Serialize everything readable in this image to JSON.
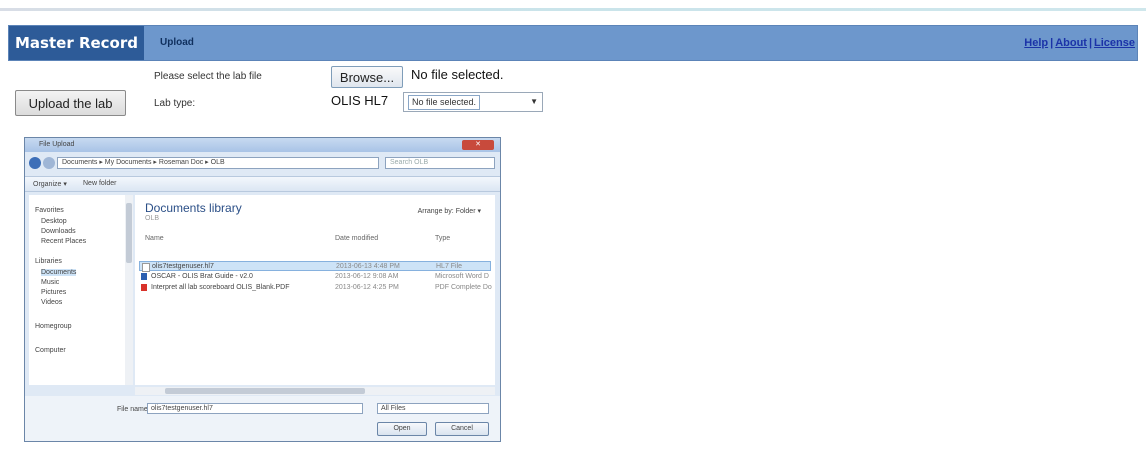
{
  "header": {
    "brand": "Master Record",
    "section": "Upload",
    "links": [
      "Help",
      "About",
      "License"
    ],
    "separator": "|"
  },
  "form": {
    "upload_button": "Upload the lab",
    "select_label": "Please select the lab file",
    "browse_button": "Browse...",
    "no_file_text": "No file selected.",
    "lab_type_label": "Lab type:",
    "lab_type_value": "OLIS HL7",
    "file_select_value": "No file selected."
  },
  "dialog": {
    "title": "File Upload",
    "address_path": "Documents ▸ My Documents ▸ Roseman Doc ▸ OLB",
    "search_placeholder": "Search OLB",
    "toolbar": [
      "Organize ▾",
      "New folder"
    ],
    "nav_items": [
      "Favorites",
      "Desktop",
      "Downloads",
      "Recent Places",
      "Libraries",
      "Documents",
      "Music",
      "Pictures",
      "Videos",
      "Homegroup",
      "Computer"
    ],
    "library_title": "Documents library",
    "library_sub": "OLB",
    "arrange_label": "Arrange by: Folder ▾",
    "columns": [
      "Name",
      "Date modified",
      "Type"
    ],
    "files": [
      {
        "name": "olis7testgenuser.hl7",
        "date": "2013-06-13 4:48 PM",
        "type": "HL7 File"
      },
      {
        "name": "OSCAR - OLIS Brat Guide - v2.0",
        "date": "2013-06-12 9:08 AM",
        "type": "Microsoft Word D"
      },
      {
        "name": "Interpret all lab scoreboard OLIS_Blank.PDF",
        "date": "2013-06-12 4:25 PM",
        "type": "PDF Complete Do"
      }
    ],
    "file_name_label": "File name:",
    "file_name_value": "olis7testgenuser.hl7",
    "file_type_value": "All Files",
    "open_button": "Open",
    "cancel_button": "Cancel"
  }
}
